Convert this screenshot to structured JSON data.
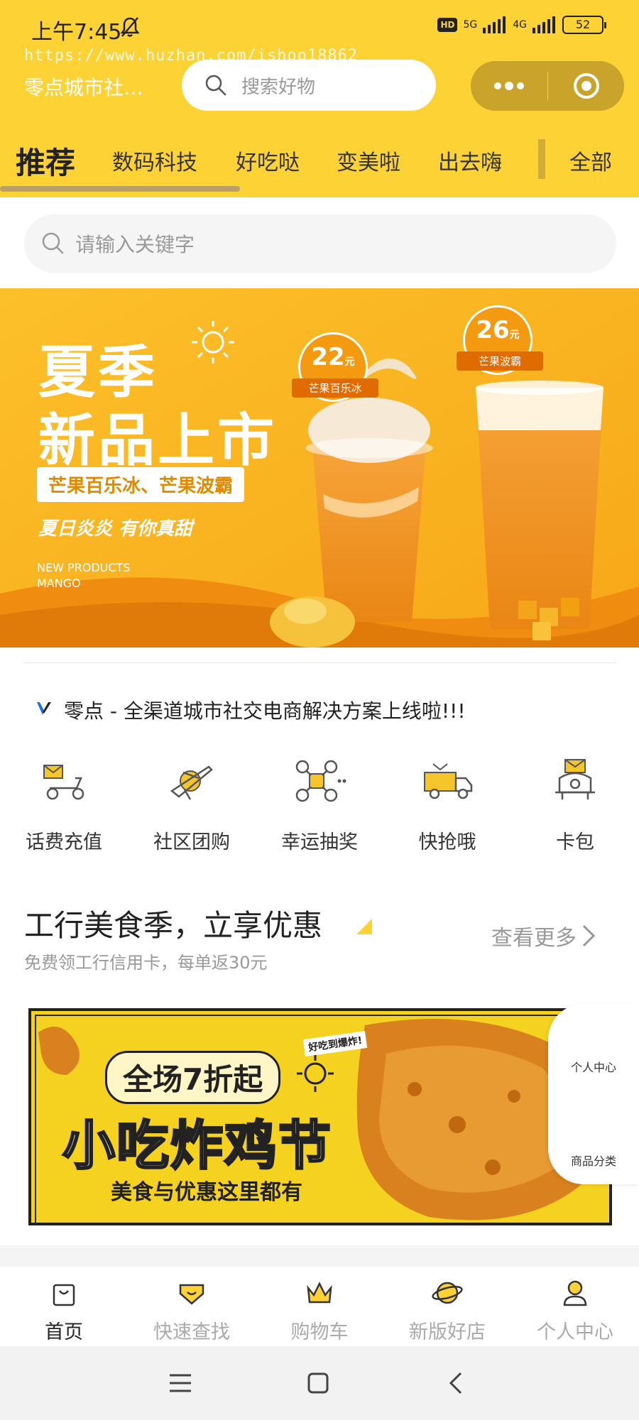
{
  "status_bar": {
    "time": "上午7:45",
    "network_labels": [
      "HD",
      "5G",
      "4G"
    ],
    "battery": "52"
  },
  "watermark": "https://www.huzhan.com/ishop18862",
  "header": {
    "shop_name": "零点城市社…",
    "search_placeholder": "搜索好物",
    "background_color": "#fdd235",
    "capsule_color": "#c9a32a"
  },
  "tabs": [
    "推荐",
    "数码科技",
    "好吃哒",
    "变美啦",
    "出去嗨",
    "全部"
  ],
  "active_tab": "推荐",
  "search": {
    "placeholder": "请输入关键字"
  },
  "hero_banner": {
    "title_line1": "夏季",
    "title_line2": "新品上市",
    "products": "芒果百乐冰、芒果波霸",
    "slogan": "夏日炎炎 有你真甜",
    "english_line1": "NEW PRODUCTS",
    "english_line2": "MANGO",
    "badge1": {
      "price": "22",
      "unit": "元",
      "name": "芒果百乐冰"
    },
    "badge2": {
      "price": "26",
      "unit": "元",
      "name": "芒果波霸"
    }
  },
  "notice": {
    "text": "零点 - 全渠道城市社交电商解决方案上线啦!!!"
  },
  "quick_menu": [
    {
      "label": "话费充值",
      "icon": "delivery-scooter-icon"
    },
    {
      "label": "社区团购",
      "icon": "airplane-icon"
    },
    {
      "label": "幸运抽奖",
      "icon": "drone-icon"
    },
    {
      "label": "快抢哦",
      "icon": "truck-icon"
    },
    {
      "label": "卡包",
      "icon": "mailbox-icon"
    }
  ],
  "promo": {
    "title": "工行美食季，立享优惠",
    "subtitle": "免费领工行信用卡，每单返30元",
    "more": "查看更多"
  },
  "food_banner": {
    "tag": "好吃到爆炸!",
    "top_text": "全场7折起",
    "main_text": "小吃炸鸡节",
    "sub_text": "美食与优惠这里都有"
  },
  "floating_tabs": [
    "个人中心",
    "商品分类"
  ],
  "tabbar": [
    {
      "label": "首页",
      "icon": "bag-icon",
      "active": true
    },
    {
      "label": "快速查找",
      "icon": "heart-badge-icon",
      "active": false
    },
    {
      "label": "购物车",
      "icon": "crown-icon",
      "active": false
    },
    {
      "label": "新版好店",
      "icon": "planet-icon",
      "active": false
    },
    {
      "label": "个人中心",
      "icon": "user-icon",
      "active": false
    }
  ],
  "accent_colors": {
    "yellow": "#fdd235",
    "orange": "#f39a11"
  }
}
